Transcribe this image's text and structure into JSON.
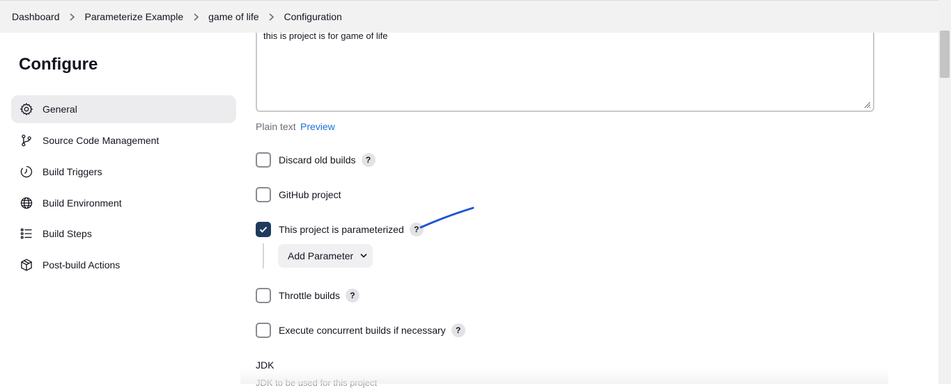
{
  "breadcrumb": {
    "items": [
      "Dashboard",
      "Parameterize Example",
      "game of life",
      "Configuration"
    ]
  },
  "sidebar": {
    "title": "Configure",
    "items": [
      {
        "label": "General",
        "icon": "gear-icon",
        "active": true
      },
      {
        "label": "Source Code Management",
        "icon": "branch-icon"
      },
      {
        "label": "Build Triggers",
        "icon": "clock-icon"
      },
      {
        "label": "Build Environment",
        "icon": "globe-icon"
      },
      {
        "label": "Build Steps",
        "icon": "list-icon"
      },
      {
        "label": "Post-build Actions",
        "icon": "package-icon"
      }
    ]
  },
  "description": {
    "value": "this is project is for game of life",
    "plain_text_label": "Plain text",
    "preview_label": "Preview"
  },
  "options": {
    "discard_old_builds": {
      "label": "Discard old builds",
      "checked": false,
      "help": "?"
    },
    "github_project": {
      "label": "GitHub project",
      "checked": false
    },
    "parameterized": {
      "label": "This project is parameterized",
      "checked": true,
      "help": "?"
    },
    "add_parameter_label": "Add Parameter",
    "throttle_builds": {
      "label": "Throttle builds",
      "checked": false,
      "help": "?"
    },
    "concurrent_builds": {
      "label": "Execute concurrent builds if necessary",
      "checked": false,
      "help": "?"
    }
  },
  "jdk": {
    "label": "JDK",
    "description": "JDK to be used for this project"
  },
  "colors": {
    "accent_link": "#1f6fd8",
    "checkbox_checked": "#1e3a5f",
    "annotation_stroke": "#1d55d6"
  }
}
